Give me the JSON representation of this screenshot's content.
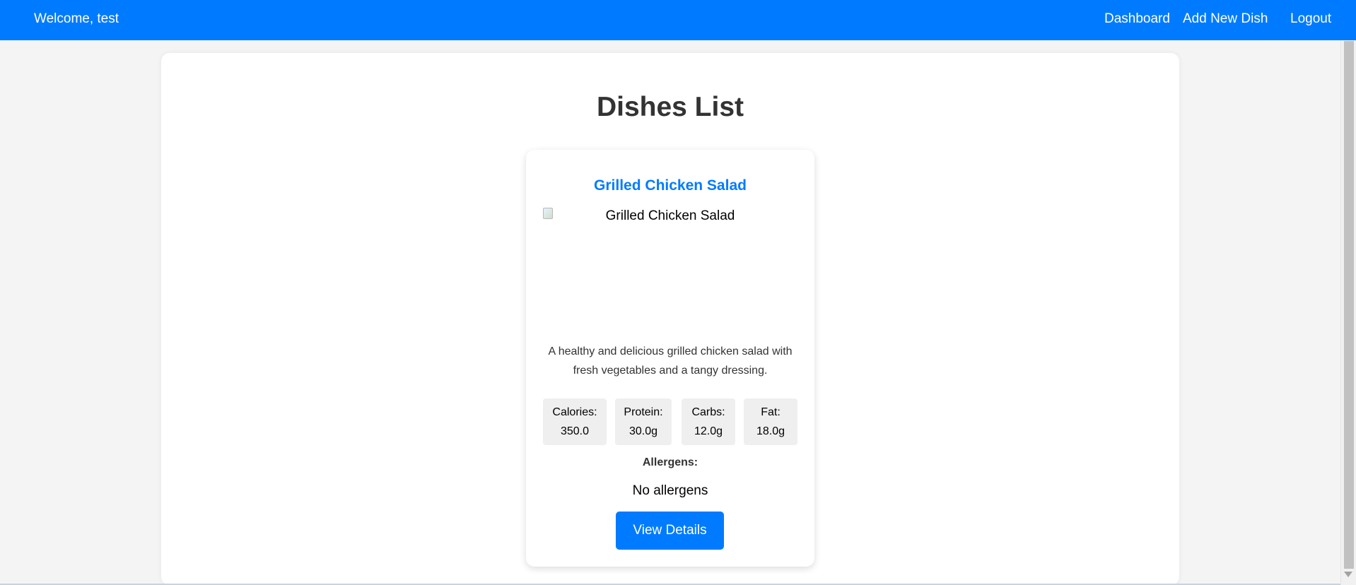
{
  "header": {
    "welcome": "Welcome, test",
    "nav": {
      "dashboard": "Dashboard",
      "add_new_dish": "Add New Dish",
      "logout": "Logout"
    }
  },
  "main": {
    "title": "Dishes List",
    "dishes": [
      {
        "name": "Grilled Chicken Salad",
        "image_alt": "Grilled Chicken Salad",
        "description": "A healthy and delicious grilled chicken salad with fresh vegetables and a tangy dressing.",
        "nutrients": [
          {
            "label": "Calories:",
            "value": "350.0"
          },
          {
            "label": "Protein:",
            "value": "30.0g"
          },
          {
            "label": "Carbs:",
            "value": "12.0g"
          },
          {
            "label": "Fat:",
            "value": "18.0g"
          }
        ],
        "allergens_label": "Allergens:",
        "allergens_value": "No allergens",
        "button_label": "View Details"
      }
    ]
  },
  "colors": {
    "primary": "#007bff",
    "page_background": "#f4f4f4",
    "card_background": "#ffffff",
    "nutrient_background": "#efefef"
  },
  "icons": {
    "broken_image": "broken-image-icon",
    "scroll_down": "chevron-down-icon"
  }
}
